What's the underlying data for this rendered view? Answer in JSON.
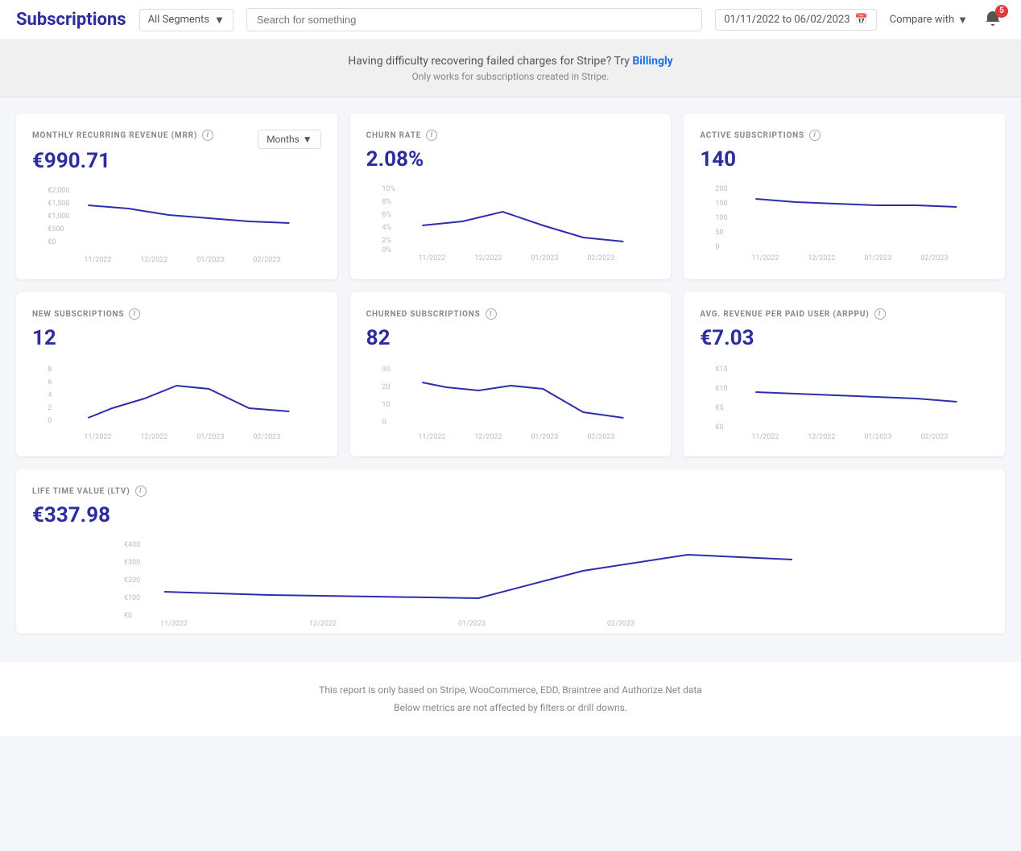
{
  "header": {
    "title": "Subscriptions",
    "segments_label": "All Segments",
    "search_placeholder": "Search for something",
    "date_range": "01/11/2022  to  06/02/2023",
    "compare_label": "Compare with",
    "notif_count": "5"
  },
  "banner": {
    "text_before": "Having difficulty recovering failed charges for Stripe? Try ",
    "link_text": "Billingly",
    "text_after": "",
    "subtext": "Only works for subscriptions created in Stripe."
  },
  "cards": {
    "mrr": {
      "title": "MONTHLY RECURRING REVENUE (MRR)",
      "value": "€990.71",
      "dropdown_label": "Months"
    },
    "churn": {
      "title": "CHURN RATE",
      "value": "2.08%"
    },
    "active": {
      "title": "ACTIVE SUBSCRIPTIONS",
      "value": "140"
    },
    "new_subs": {
      "title": "NEW SUBSCRIPTIONS",
      "value": "12"
    },
    "churned": {
      "title": "CHURNED SUBSCRIPTIONS",
      "value": "82"
    },
    "arppu": {
      "title": "AVG. REVENUE PER PAID USER (ARPPU)",
      "value": "€7.03"
    },
    "ltv": {
      "title": "LIFE TIME VALUE (LTV)",
      "value": "€337.98"
    }
  },
  "footer": {
    "line1": "This report is only based on Stripe, WooCommerce, EDD, Braintree and Authorize.Net data",
    "line2": "Below metrics are not affected by filters or drill downs."
  }
}
